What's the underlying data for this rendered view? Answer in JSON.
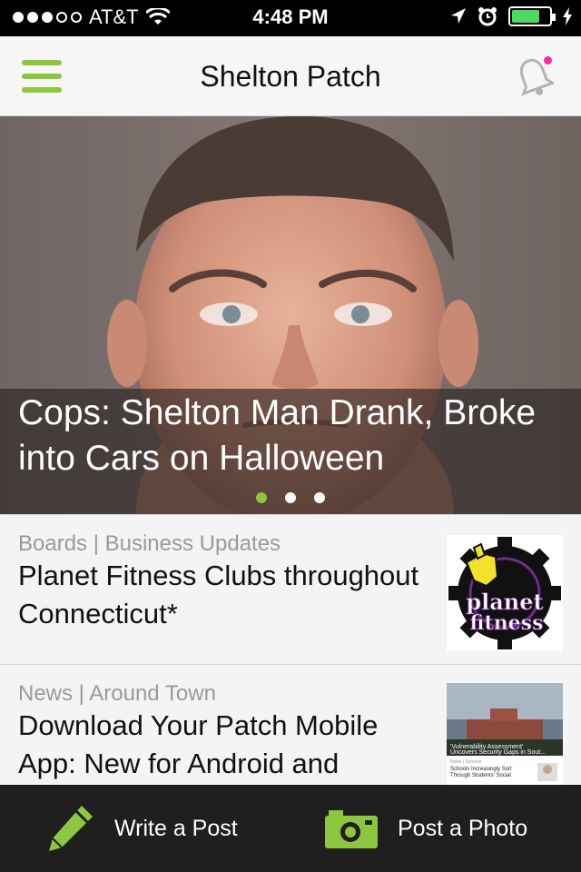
{
  "status_bar": {
    "carrier": "AT&T",
    "time": "4:48 PM",
    "signal_bars_filled": 3,
    "signal_bars_total": 5,
    "battery_level": 0.7
  },
  "nav": {
    "title": "Shelton Patch",
    "accent_color": "#8dc63f",
    "notification_dot_color": "#ff2a9d"
  },
  "hero": {
    "headline": "Cops: Shelton Man Drank, Broke into Cars on Halloween",
    "page_count": 3,
    "active_page": 1
  },
  "feed": [
    {
      "category": "Boards | Business Updates",
      "title": "Planet Fitness Clubs throughout Connecticut*",
      "thumb_text_line1": "planet",
      "thumb_text_line2": "fitness"
    },
    {
      "category": "News | Around Town",
      "title": "Download Your Patch Mobile App: New for Android and",
      "thumb_caption": "'Vulnerability Assessment' Uncovers Security Gaps in Sout...",
      "thumb_sub_category": "News | Schools",
      "thumb_sub_title": "Schools Increasingly Sort Through Students' Social"
    }
  ],
  "bottom_bar": {
    "write_label": "Write a Post",
    "photo_label": "Post a Photo"
  }
}
